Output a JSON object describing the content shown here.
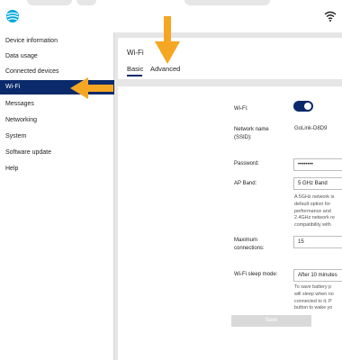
{
  "sidebar": {
    "items": [
      {
        "label": "Device information"
      },
      {
        "label": "Data usage"
      },
      {
        "label": "Connected devices"
      },
      {
        "label": "Wi-Fi"
      },
      {
        "label": "Messages"
      },
      {
        "label": "Networking"
      },
      {
        "label": "System"
      },
      {
        "label": "Software update"
      },
      {
        "label": "Help"
      }
    ],
    "active_index": 3
  },
  "header": {
    "title": "Wi-Fi",
    "tabs": [
      {
        "label": "Basic",
        "selected": true
      },
      {
        "label": "Advanced",
        "selected": false
      }
    ]
  },
  "form": {
    "wifi_label": "Wi-Fi:",
    "wifi_enabled": true,
    "network_name_label": "Network name\n(SSID):",
    "network_name_value": "GoLink-D8D9",
    "password_label": "Password:",
    "password_value": "••••••••",
    "ap_band_label": "AP Band:",
    "ap_band_value": "5 GHz Band",
    "ap_band_hint": "A 5GHz network is\ndefault option for\nperformance and\n2.4GHz network re\ncompatibility with",
    "max_connections_label": "Maximum\nconnections:",
    "max_connections_value": "15",
    "sleep_mode_label": "Wi-Fi sleep mode:",
    "sleep_mode_value": "After 10 minutes",
    "sleep_mode_hint": "To save battery p\nwill sleep when no\nconnected to it. P\nbutton to wake yo",
    "save_label": "Save"
  },
  "colors": {
    "accent": "#0b2a6b",
    "arrow": "#f5a623",
    "background": "#e6e6e6"
  },
  "icons": {
    "logo": "att-globe-icon",
    "status": "wifi-signal-icon",
    "annotation": "orange-arrow-icon"
  }
}
